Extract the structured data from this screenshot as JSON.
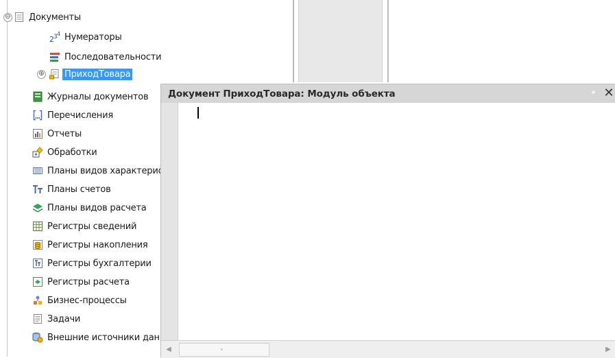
{
  "tree": {
    "items": [
      {
        "label": "Документы",
        "icon": "document-icon",
        "toggle": "⊖"
      },
      {
        "label": "Нумераторы",
        "icon": "numerator-icon"
      },
      {
        "label": "Последовательности",
        "icon": "sequence-icon"
      },
      {
        "label": "ПриходТовара",
        "icon": "document-item-icon",
        "toggle": "⊕",
        "selected": true
      },
      {
        "label": "Журналы документов",
        "icon": "journal-icon"
      },
      {
        "label": "Перечисления",
        "icon": "enum-icon"
      },
      {
        "label": "Отчеты",
        "icon": "report-icon"
      },
      {
        "label": "Обработки",
        "icon": "processing-icon"
      },
      {
        "label": "Планы видов характеристик",
        "icon": "chart-characteristics-icon"
      },
      {
        "label": "Планы счетов",
        "icon": "chart-accounts-icon"
      },
      {
        "label": "Планы видов расчета",
        "icon": "chart-calc-icon"
      },
      {
        "label": "Регистры сведений",
        "icon": "info-register-icon"
      },
      {
        "label": "Регистры накопления",
        "icon": "accum-register-icon"
      },
      {
        "label": "Регистры бухгалтерии",
        "icon": "accounting-register-icon"
      },
      {
        "label": "Регистры расчета",
        "icon": "calc-register-icon"
      },
      {
        "label": "Бизнес-процессы",
        "icon": "business-process-icon"
      },
      {
        "label": "Задачи",
        "icon": "task-icon"
      },
      {
        "label": "Внешние источники данных",
        "icon": "external-source-icon"
      }
    ]
  },
  "module_window": {
    "title": "Документ ПриходТовара: Модуль объекта",
    "close_label": "✕"
  },
  "colors": {
    "selection": "#3399ff",
    "title_bar": "#d6d6d6"
  }
}
